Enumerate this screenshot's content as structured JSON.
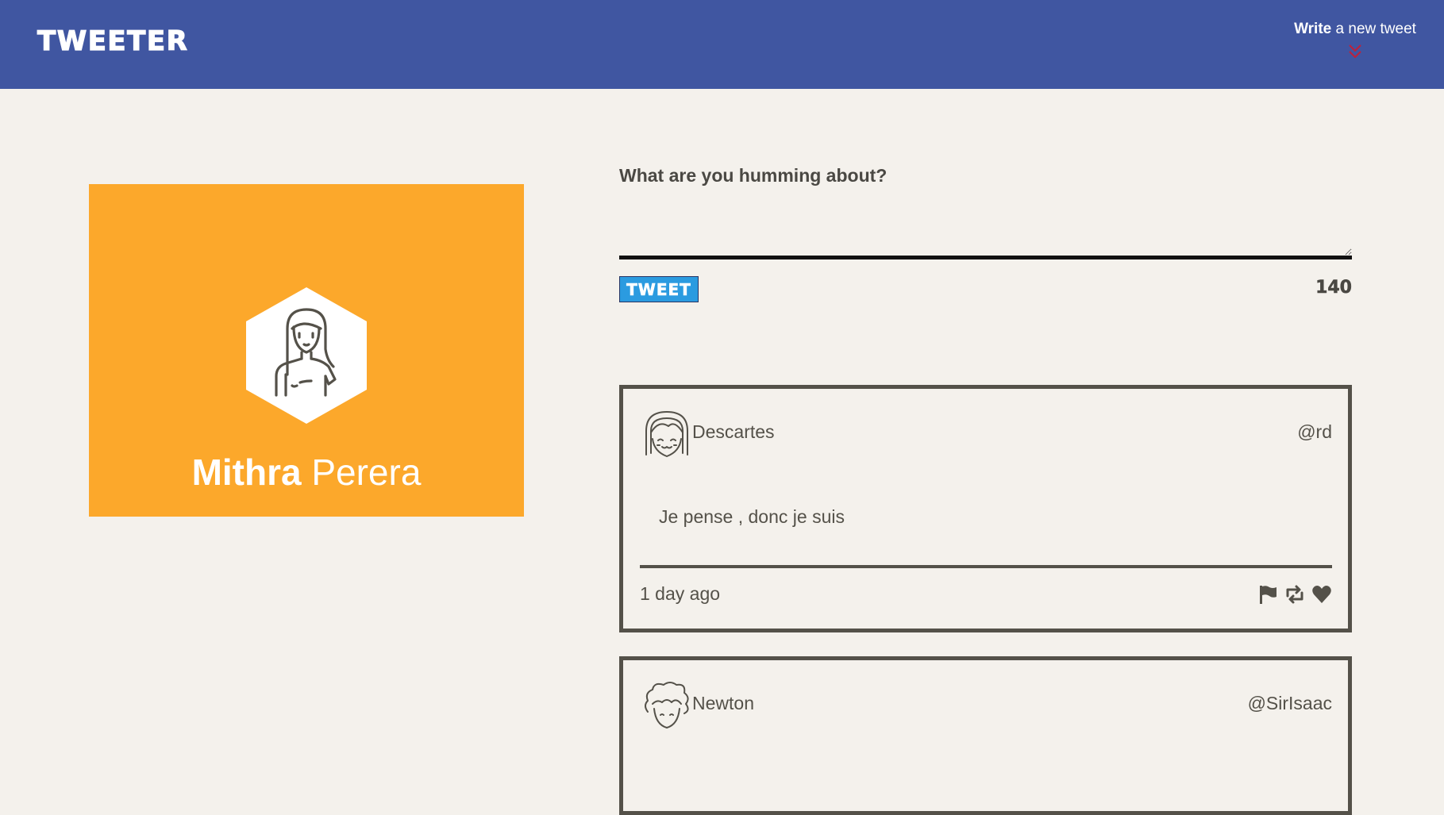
{
  "nav": {
    "brand": "TWEETER",
    "compose_toggle_bold": "Write",
    "compose_toggle_rest": " a new tweet",
    "toggle_icon": "double-chevron-down-icon",
    "toggle_icon_color": "#c0203a"
  },
  "profile": {
    "first_name": "Mithra",
    "last_name": " Perera",
    "avatar_icon": "woman-avatar-icon",
    "background_color": "#fca82b"
  },
  "compose": {
    "label": "What are you humming about?",
    "textarea_value": "",
    "button_label": "TWEET",
    "counter": "140"
  },
  "tweets": [
    {
      "name": "Descartes",
      "handle": "@rd",
      "content": "Je pense , donc je suis",
      "time": "1 day ago",
      "avatar_icon": "descartes-avatar-icon",
      "actions": [
        "flag-icon",
        "retweet-icon",
        "heart-icon"
      ]
    },
    {
      "name": "Newton",
      "handle": "@SirIsaac",
      "avatar_icon": "newton-avatar-icon"
    }
  ],
  "colors": {
    "nav": "#4056a1",
    "page_bg": "#f4f1ec",
    "tweet_button": "#2b9be0",
    "text": "#545149"
  }
}
